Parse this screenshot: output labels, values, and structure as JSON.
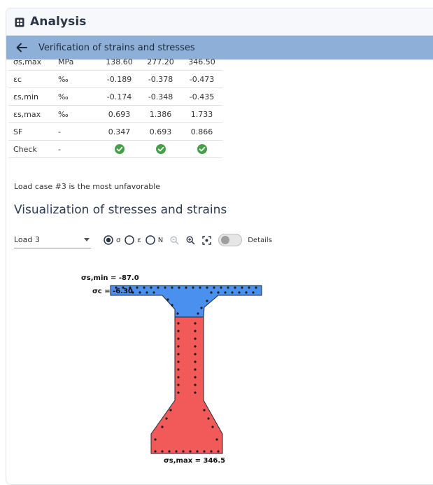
{
  "window": {
    "title": "Analysis",
    "title_icon": "grid-icon"
  },
  "subheader": {
    "back_icon": "arrow-left-icon",
    "title": "Verification of strains and stresses"
  },
  "table": {
    "rows": [
      {
        "label": "σs,max",
        "unit": "MPa",
        "v1": "138.60",
        "v2": "277.20",
        "v3": "346.50"
      },
      {
        "label": "εc",
        "unit": "‰",
        "v1": "-0.189",
        "v2": "-0.378",
        "v3": "-0.473"
      },
      {
        "label": "εs,min",
        "unit": "‰",
        "v1": "-0.174",
        "v2": "-0.348",
        "v3": "-0.435"
      },
      {
        "label": "εs,max",
        "unit": "‰",
        "v1": "0.693",
        "v2": "1.386",
        "v3": "1.733"
      },
      {
        "label": "SF",
        "unit": "-",
        "v1": "0.347",
        "v2": "0.693",
        "v3": "0.866"
      }
    ],
    "check_row": {
      "label": "Check",
      "unit": "-",
      "icon": "check-circle-icon",
      "color": "#43a047"
    }
  },
  "note": "Load case #3 is the most unfavorable",
  "section_title": "Visualization of stresses and strains",
  "controls": {
    "load_select": "Load 3",
    "radios": [
      {
        "label": "σ",
        "selected": true
      },
      {
        "label": "ε",
        "selected": false
      },
      {
        "label": "N",
        "selected": false
      }
    ],
    "tool_icons": [
      "zoom-out-icon",
      "zoom-in-icon",
      "fit-view-icon"
    ],
    "details_toggle_on": false,
    "details_label": "Details"
  },
  "visualization": {
    "label_smin": "σs,min = -87.0",
    "label_sc": "σc = -6.30",
    "label_smax": "σs,max = 346.5",
    "compression_color": "#4a90ee",
    "tension_color": "#f25a5a"
  }
}
